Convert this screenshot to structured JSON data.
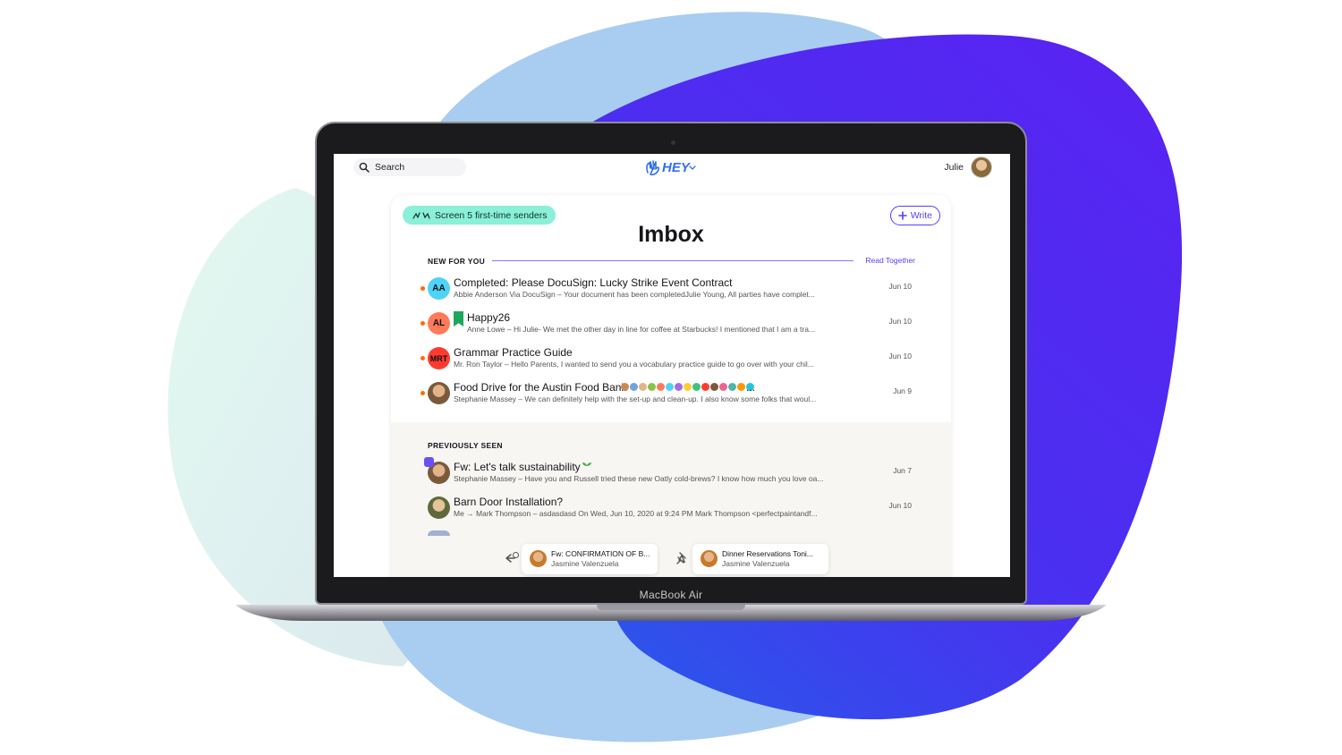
{
  "app": {
    "logo_text": "HEY",
    "user_name": "Julie",
    "search_label": "Search"
  },
  "toolbar": {
    "screen_pill": "Screen 5 first-time senders",
    "write_label": "Write"
  },
  "imbox": {
    "title": "Imbox",
    "new_section": "NEW FOR YOU",
    "read_together": "Read Together",
    "previous_section": "PREVIOUSLY SEEN"
  },
  "new_emails": [
    {
      "initials": "AA",
      "avatar_color": "#4fd3f7",
      "subject": "Completed: Please DocuSign: Lucky Strike Event Contract",
      "snippet": "Abbie Anderson Via DocuSign – Your document has been completedJulie Young, All parties have complet...",
      "date": "Jun 10"
    },
    {
      "initials": "AL",
      "avatar_color": "#ff7a59",
      "subject": "Happy26",
      "snippet": "Anne Lowe – Hi Julie- We met the other day in line for coffee at Starbucks! I mentioned that I am a tra...",
      "date": "Jun 10"
    },
    {
      "initials": "MRT",
      "avatar_color": "#ff3b30",
      "subject": "Grammar Practice Guide",
      "snippet": "Mr. Ron Taylor – Hello Parents, I wanted to send you a vocabulary practice guide to go over with your chil...",
      "date": "Jun 10"
    },
    {
      "initials": "",
      "avatar_color": "#7a5a3a",
      "subject": "Food Drive for the Austin Food Bank",
      "snippet": "Stephanie Massey – We can definitely help with the set-up and clean-up. I also know some folks that woul...",
      "date": "Jun 9",
      "more": "..."
    }
  ],
  "previous_emails": [
    {
      "subject": "Fw: Let's talk sustainability",
      "snippet": "Stephanie Massey – Have you and Russell tried these new Oatly cold-brews? I know how much you love oa...",
      "date": "Jun 7"
    },
    {
      "subject": "Barn Door Installation?",
      "snippet": "Me → Mark Thompson – asdasdasd On Wed, Jun 10, 2020 at 9:24 PM Mark Thompson <perfectpaintandf...",
      "date": "Jun 10"
    }
  ],
  "tray": [
    {
      "title": "Fw: CONFIRMATION OF B...",
      "sender": "Jasmine Valenzuela"
    },
    {
      "title": "Dinner Reservations Toni...",
      "sender": "Jasmine Valenzuela"
    }
  ],
  "device": {
    "label": "MacBook Air"
  },
  "colors": {
    "accent": "#5b3cf5",
    "unread_dot": "#ff6a00",
    "pill": "#8af0d8",
    "blob_dark": "#4b22f0",
    "blob_light": "#a9cdf0",
    "blob_mint": "#dff5ee"
  },
  "icons": {
    "search": "search-icon",
    "write": "plus-icon",
    "screen": "hands-icon",
    "bookmark": "bookmark-icon",
    "reply_later": "reply-later-icon",
    "set_aside": "pin-icon"
  }
}
